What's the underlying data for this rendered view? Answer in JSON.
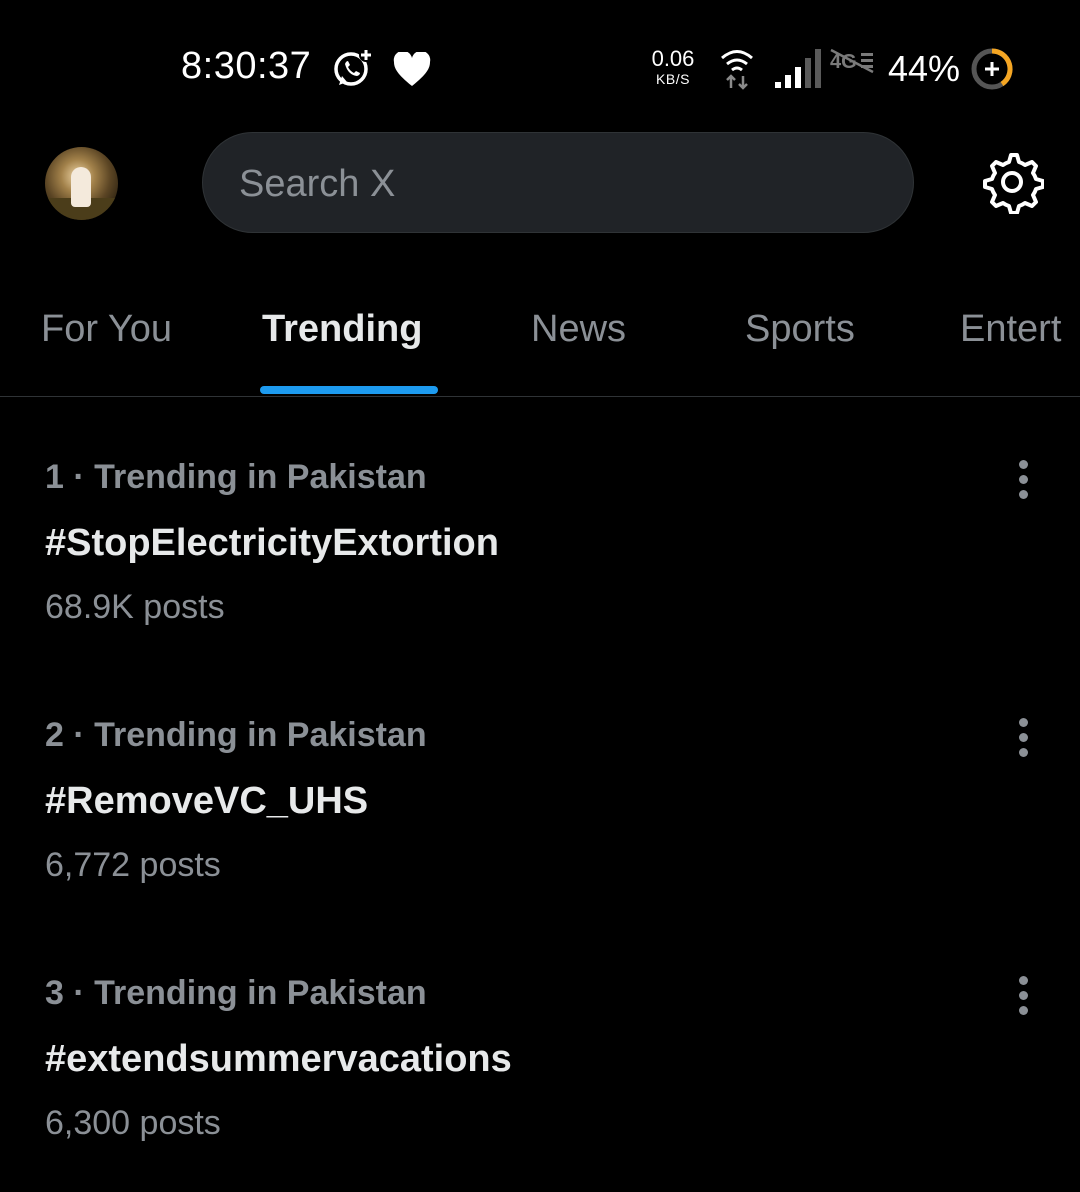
{
  "status_bar": {
    "time": "8:30:37",
    "net_speed_value": "0.06",
    "net_speed_unit": "KB/S",
    "battery": "44%",
    "icons": [
      "whatsapp-icon",
      "heart-icon",
      "wifi-icon",
      "signal-icon",
      "4g-off-icon",
      "battery-saver-icon"
    ]
  },
  "header": {
    "search_placeholder": "Search X",
    "avatar_icon": "avatar",
    "settings_icon": "gear-icon"
  },
  "tabs": [
    {
      "label": "For You"
    },
    {
      "label": "Trending"
    },
    {
      "label": "News"
    },
    {
      "label": "Sports"
    },
    {
      "label": "Entert"
    }
  ],
  "active_tab": "Trending",
  "accent_color": "#1d9bf0",
  "trends": [
    {
      "meta": "1 · Trending in Pakistan",
      "title": "#StopElectricityExtortion",
      "count": "68.9K posts"
    },
    {
      "meta": "2 · Trending in Pakistan",
      "title": "#RemoveVC_UHS",
      "count": "6,772 posts"
    },
    {
      "meta": "3 · Trending in Pakistan",
      "title": "#extendsummervacations",
      "count": "6,300 posts"
    }
  ]
}
